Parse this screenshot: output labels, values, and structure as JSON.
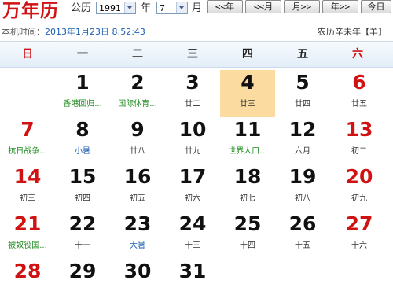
{
  "app": {
    "logo": "万年历"
  },
  "controls": {
    "calendar_label": "公历",
    "year_value": "1991",
    "year_label": "年",
    "month_value": "7",
    "month_label": "月",
    "prev_year": "<<年",
    "prev_month": "<<月",
    "next_month": "月>>",
    "next_year": "年>>",
    "today": "今日"
  },
  "info": {
    "time_label": "本机时间：",
    "time_value": "2013年1月23日 8:52:43",
    "lunar_year": "农历辛未年【羊】"
  },
  "weekdays": [
    "日",
    "一",
    "二",
    "三",
    "四",
    "五",
    "六"
  ],
  "days": [
    {
      "d": "1",
      "l": "香港回归...",
      "dred": false,
      "lc": "green"
    },
    {
      "d": "2",
      "l": "国际体育...",
      "dred": false,
      "lc": "green"
    },
    {
      "d": "3",
      "l": "廿二",
      "dred": false,
      "lc": ""
    },
    {
      "d": "4",
      "l": "廿三",
      "dred": false,
      "lc": "",
      "today": true
    },
    {
      "d": "5",
      "l": "廿四",
      "dred": false,
      "lc": ""
    },
    {
      "d": "6",
      "l": "廿五",
      "dred": true,
      "lc": ""
    },
    {
      "d": "7",
      "l": "抗日战争...",
      "dred": true,
      "lc": "green"
    },
    {
      "d": "8",
      "l": "小暑",
      "dred": false,
      "lc": "blue"
    },
    {
      "d": "9",
      "l": "廿八",
      "dred": false,
      "lc": ""
    },
    {
      "d": "10",
      "l": "廿九",
      "dred": false,
      "lc": ""
    },
    {
      "d": "11",
      "l": "世界人口...",
      "dred": false,
      "lc": "green"
    },
    {
      "d": "12",
      "l": "六月",
      "dred": false,
      "lc": ""
    },
    {
      "d": "13",
      "l": "初二",
      "dred": true,
      "lc": ""
    },
    {
      "d": "14",
      "l": "初三",
      "dred": true,
      "lc": ""
    },
    {
      "d": "15",
      "l": "初四",
      "dred": false,
      "lc": ""
    },
    {
      "d": "16",
      "l": "初五",
      "dred": false,
      "lc": ""
    },
    {
      "d": "17",
      "l": "初六",
      "dred": false,
      "lc": ""
    },
    {
      "d": "18",
      "l": "初七",
      "dred": false,
      "lc": ""
    },
    {
      "d": "19",
      "l": "初八",
      "dred": false,
      "lc": ""
    },
    {
      "d": "20",
      "l": "初九",
      "dred": true,
      "lc": ""
    },
    {
      "d": "21",
      "l": "被奴役国...",
      "dred": true,
      "lc": "green"
    },
    {
      "d": "22",
      "l": "十一",
      "dred": false,
      "lc": ""
    },
    {
      "d": "23",
      "l": "大暑",
      "dred": false,
      "lc": "blue"
    },
    {
      "d": "24",
      "l": "十三",
      "dred": false,
      "lc": ""
    },
    {
      "d": "25",
      "l": "十四",
      "dred": false,
      "lc": ""
    },
    {
      "d": "26",
      "l": "十五",
      "dred": false,
      "lc": ""
    },
    {
      "d": "27",
      "l": "十六",
      "dred": true,
      "lc": ""
    },
    {
      "d": "28",
      "l": "",
      "dred": true,
      "lc": ""
    },
    {
      "d": "29",
      "l": "",
      "dred": false,
      "lc": ""
    },
    {
      "d": "30",
      "l": "",
      "dred": false,
      "lc": ""
    },
    {
      "d": "31",
      "l": "",
      "dred": false,
      "lc": ""
    }
  ],
  "first_weekday_index": 1,
  "colors": {
    "accent_red": "#d01212",
    "today_bg": "#fbdba0",
    "festival_green": "#1c8a1c",
    "solar_term_blue": "#1b5fb0"
  }
}
